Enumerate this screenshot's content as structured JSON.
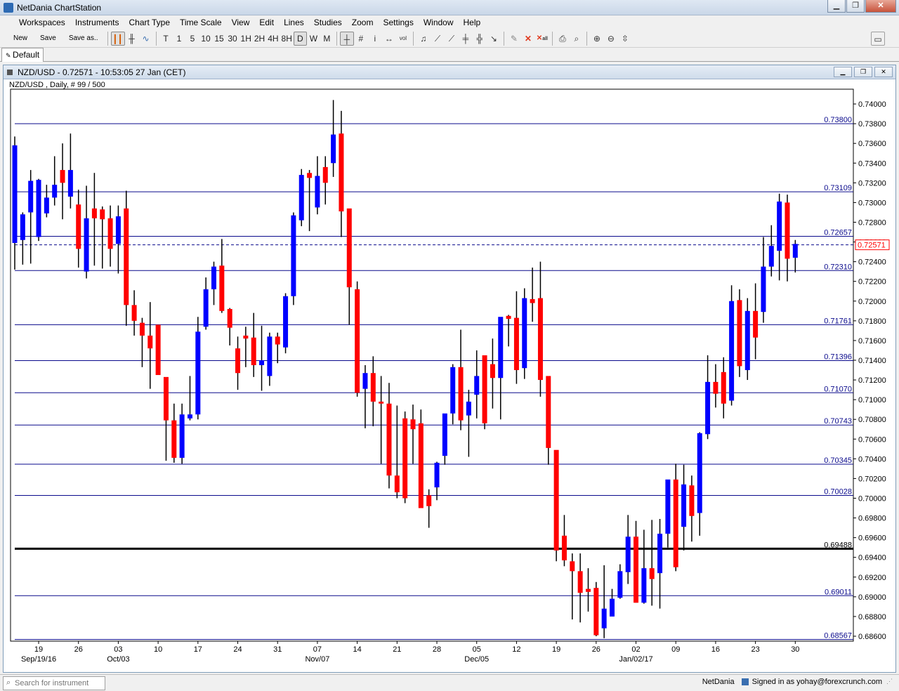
{
  "window": {
    "title": "NetDania ChartStation"
  },
  "window_controls": {
    "minimize": "▁",
    "restore": "❐",
    "close": "✕"
  },
  "menu": [
    "Workspaces",
    "Instruments",
    "Chart Type",
    "Time Scale",
    "View",
    "Edit",
    "Lines",
    "Studies",
    "Zoom",
    "Settings",
    "Window",
    "Help"
  ],
  "toolbar": {
    "new_label": "New",
    "save_label": "Save",
    "saveas_label": "Save as..",
    "timeframes": [
      "T",
      "1",
      "5",
      "10",
      "15",
      "30",
      "1H",
      "2H",
      "4H",
      "8H",
      "D",
      "W",
      "M"
    ],
    "active_timeframe": "D",
    "vol_label": "vol",
    "all_label": "all"
  },
  "tabs": [
    {
      "label": "Default",
      "active": true
    }
  ],
  "chart_window": {
    "title": "NZD/USD - 0.72571 - 10:53:05  27 Jan (CET)"
  },
  "status": {
    "search_placeholder": "Search for instrument",
    "provider": "NetDania",
    "signed_in": "Signed in as yohay@forexcrunch.com"
  },
  "colors": {
    "bull": "#0000ff",
    "bear": "#ff0000",
    "hline": "#0a0a8c",
    "support": "#000000"
  },
  "chart_data": {
    "type": "candlestick",
    "info": "NZD/USD , Daily, # 99 / 500",
    "ylim": [
      0.6855,
      0.7415
    ],
    "y_ticks": [
      "0.74000",
      "0.73800",
      "0.73600",
      "0.73400",
      "0.73200",
      "0.73000",
      "0.72800",
      "0.72600",
      "0.72400",
      "0.72200",
      "0.72000",
      "0.71800",
      "0.71600",
      "0.71400",
      "0.71200",
      "0.71000",
      "0.70800",
      "0.70600",
      "0.70400",
      "0.70200",
      "0.70000",
      "0.69800",
      "0.69600",
      "0.69400",
      "0.69200",
      "0.69000",
      "0.68800",
      "0.68600"
    ],
    "x_labels": [
      {
        "i": 3,
        "day": "19",
        "month": "Sep/19/16"
      },
      {
        "i": 8,
        "day": "26",
        "month": ""
      },
      {
        "i": 13,
        "day": "03",
        "month": "Oct/03"
      },
      {
        "i": 18,
        "day": "10",
        "month": ""
      },
      {
        "i": 23,
        "day": "17",
        "month": ""
      },
      {
        "i": 28,
        "day": "24",
        "month": ""
      },
      {
        "i": 33,
        "day": "31",
        "month": ""
      },
      {
        "i": 38,
        "day": "07",
        "month": "Nov/07"
      },
      {
        "i": 43,
        "day": "14",
        "month": ""
      },
      {
        "i": 48,
        "day": "21",
        "month": ""
      },
      {
        "i": 53,
        "day": "28",
        "month": ""
      },
      {
        "i": 58,
        "day": "05",
        "month": "Dec/05"
      },
      {
        "i": 63,
        "day": "12",
        "month": ""
      },
      {
        "i": 68,
        "day": "19",
        "month": ""
      },
      {
        "i": 73,
        "day": "26",
        "month": ""
      },
      {
        "i": 78,
        "day": "02",
        "month": "Jan/02/17"
      },
      {
        "i": 83,
        "day": "09",
        "month": ""
      },
      {
        "i": 88,
        "day": "16",
        "month": ""
      },
      {
        "i": 93,
        "day": "23",
        "month": ""
      },
      {
        "i": 98,
        "day": "30",
        "month": ""
      }
    ],
    "hlines": [
      {
        "value": 0.738,
        "label": "0.73800",
        "thick": false
      },
      {
        "value": 0.73109,
        "label": "0.73109",
        "thick": false
      },
      {
        "value": 0.72657,
        "label": "0.72657",
        "thick": false
      },
      {
        "value": 0.7231,
        "label": "0.72310",
        "thick": false
      },
      {
        "value": 0.71761,
        "label": "0.71761",
        "thick": false
      },
      {
        "value": 0.71396,
        "label": "0.71396",
        "thick": false
      },
      {
        "value": 0.7107,
        "label": "0.71070",
        "thick": false
      },
      {
        "value": 0.70743,
        "label": "0.70743",
        "thick": false
      },
      {
        "value": 0.70345,
        "label": "0.70345",
        "thick": false
      },
      {
        "value": 0.70028,
        "label": "0.70028",
        "thick": false
      },
      {
        "value": 0.69488,
        "label": "0.69488",
        "thick": true
      },
      {
        "value": 0.69011,
        "label": "0.69011",
        "thick": false
      },
      {
        "value": 0.68567,
        "label": "0.68567",
        "thick": false
      }
    ],
    "current_price": {
      "value": 0.72571,
      "label": "0.72571"
    },
    "candles": [
      [
        0.7259,
        0.7367,
        0.7232,
        0.7358
      ],
      [
        0.7262,
        0.729,
        0.7237,
        0.7288
      ],
      [
        0.729,
        0.7333,
        0.7238,
        0.7322
      ],
      [
        0.7265,
        0.7324,
        0.7261,
        0.7323
      ],
      [
        0.7289,
        0.7318,
        0.7285,
        0.7305
      ],
      [
        0.7305,
        0.7347,
        0.7297,
        0.7318
      ],
      [
        0.7333,
        0.736,
        0.7283,
        0.732
      ],
      [
        0.7306,
        0.737,
        0.7294,
        0.7333
      ],
      [
        0.7298,
        0.7313,
        0.7234,
        0.7253
      ],
      [
        0.723,
        0.7317,
        0.7223,
        0.7284
      ],
      [
        0.7294,
        0.733,
        0.7236,
        0.7284
      ],
      [
        0.7293,
        0.7296,
        0.7233,
        0.7283
      ],
      [
        0.7284,
        0.7297,
        0.7235,
        0.7253
      ],
      [
        0.7258,
        0.7297,
        0.7228,
        0.7286
      ],
      [
        0.7294,
        0.7312,
        0.7175,
        0.7196
      ],
      [
        0.7196,
        0.7211,
        0.7165,
        0.718
      ],
      [
        0.7178,
        0.7183,
        0.7133,
        0.7165
      ],
      [
        0.7165,
        0.7199,
        0.7111,
        0.7152
      ],
      [
        0.7176,
        0.7174,
        0.7128,
        0.7125
      ],
      [
        0.7123,
        0.7095,
        0.7038,
        0.7079
      ],
      [
        0.7079,
        0.7096,
        0.7036,
        0.7041
      ],
      [
        0.7041,
        0.7096,
        0.7035,
        0.7085
      ],
      [
        0.7081,
        0.7124,
        0.7079,
        0.7085
      ],
      [
        0.7085,
        0.7184,
        0.708,
        0.7169
      ],
      [
        0.7174,
        0.7224,
        0.7171,
        0.7212
      ],
      [
        0.7212,
        0.724,
        0.7196,
        0.7235
      ],
      [
        0.7236,
        0.7263,
        0.7188,
        0.719
      ],
      [
        0.7192,
        0.7193,
        0.7155,
        0.7173
      ],
      [
        0.7152,
        0.7164,
        0.711,
        0.7127
      ],
      [
        0.7165,
        0.7174,
        0.7133,
        0.7162
      ],
      [
        0.7163,
        0.7188,
        0.7123,
        0.7135
      ],
      [
        0.7135,
        0.7175,
        0.7109,
        0.714
      ],
      [
        0.7124,
        0.7168,
        0.7114,
        0.7164
      ],
      [
        0.7164,
        0.7168,
        0.7137,
        0.7156
      ],
      [
        0.7153,
        0.7208,
        0.7147,
        0.7205
      ],
      [
        0.7205,
        0.729,
        0.7196,
        0.7287
      ],
      [
        0.7282,
        0.7334,
        0.7276,
        0.7328
      ],
      [
        0.733,
        0.7333,
        0.7271,
        0.7325
      ],
      [
        0.7295,
        0.7347,
        0.7288,
        0.7327
      ],
      [
        0.7336,
        0.7347,
        0.7298,
        0.732
      ],
      [
        0.734,
        0.7404,
        0.7326,
        0.7369
      ],
      [
        0.737,
        0.7393,
        0.7265,
        0.7291
      ],
      [
        0.7294,
        0.7292,
        0.7176,
        0.7214
      ],
      [
        0.7212,
        0.722,
        0.7103,
        0.7107
      ],
      [
        0.7111,
        0.7135,
        0.7071,
        0.7127
      ],
      [
        0.7127,
        0.7144,
        0.7073,
        0.7098
      ],
      [
        0.7098,
        0.7124,
        0.7035,
        0.7096
      ],
      [
        0.7096,
        0.7117,
        0.701,
        0.7023
      ],
      [
        0.7023,
        0.7094,
        0.7,
        0.7006
      ],
      [
        0.7081,
        0.7088,
        0.6995,
        0.7
      ],
      [
        0.708,
        0.7095,
        0.7035,
        0.707
      ],
      [
        0.7076,
        0.709,
        0.7003,
        0.699
      ],
      [
        0.7003,
        0.7009,
        0.697,
        0.6992
      ],
      [
        0.7011,
        0.7037,
        0.6998,
        0.7036
      ],
      [
        0.7043,
        0.7085,
        0.7034,
        0.7086
      ],
      [
        0.7086,
        0.7136,
        0.7075,
        0.7133
      ],
      [
        0.7133,
        0.7171,
        0.7069,
        0.7079
      ],
      [
        0.7084,
        0.711,
        0.7042,
        0.7098
      ],
      [
        0.7105,
        0.715,
        0.7081,
        0.7124
      ],
      [
        0.7145,
        0.7142,
        0.707,
        0.7076
      ],
      [
        0.7136,
        0.7162,
        0.7091,
        0.7122
      ],
      [
        0.7122,
        0.7182,
        0.708,
        0.7184
      ],
      [
        0.7185,
        0.7186,
        0.7154,
        0.7182
      ],
      [
        0.7183,
        0.721,
        0.7116,
        0.713
      ],
      [
        0.7132,
        0.7213,
        0.7121,
        0.7203
      ],
      [
        0.7202,
        0.7234,
        0.7179,
        0.7198
      ],
      [
        0.7203,
        0.724,
        0.7103,
        0.712
      ],
      [
        0.7124,
        0.7123,
        0.7034,
        0.7051
      ],
      [
        0.7049,
        0.7048,
        0.6936,
        0.6947
      ],
      [
        0.6962,
        0.6983,
        0.6931,
        0.6937
      ],
      [
        0.6936,
        0.6944,
        0.6877,
        0.6926
      ],
      [
        0.6926,
        0.6944,
        0.6874,
        0.6904
      ],
      [
        0.6908,
        0.6929,
        0.6885,
        0.6905
      ],
      [
        0.6909,
        0.6915,
        0.686,
        0.6861
      ],
      [
        0.6868,
        0.6932,
        0.6858,
        0.6888
      ],
      [
        0.688,
        0.6908,
        0.688,
        0.6898
      ],
      [
        0.6899,
        0.6933,
        0.6898,
        0.6926
      ],
      [
        0.6925,
        0.6983,
        0.6913,
        0.6961
      ],
      [
        0.6961,
        0.6977,
        0.6894,
        0.6894
      ],
      [
        0.6894,
        0.6968,
        0.6893,
        0.6929
      ],
      [
        0.6929,
        0.6978,
        0.6891,
        0.6918
      ],
      [
        0.6924,
        0.6979,
        0.6888,
        0.6964
      ],
      [
        0.6964,
        0.6996,
        0.695,
        0.7019
      ],
      [
        0.7019,
        0.7035,
        0.6926,
        0.693
      ],
      [
        0.6971,
        0.7034,
        0.6947,
        0.7014
      ],
      [
        0.7013,
        0.7023,
        0.6956,
        0.6982
      ],
      [
        0.6985,
        0.7067,
        0.6962,
        0.7066
      ],
      [
        0.7065,
        0.7145,
        0.706,
        0.7118
      ],
      [
        0.7118,
        0.7136,
        0.7092,
        0.7106
      ],
      [
        0.7128,
        0.7143,
        0.7081,
        0.7096
      ],
      [
        0.7099,
        0.7216,
        0.7094,
        0.72
      ],
      [
        0.7201,
        0.7212,
        0.7123,
        0.7134
      ],
      [
        0.713,
        0.7203,
        0.712,
        0.719
      ],
      [
        0.719,
        0.7218,
        0.7141,
        0.7163
      ],
      [
        0.7189,
        0.7265,
        0.7178,
        0.7235
      ],
      [
        0.7235,
        0.7277,
        0.7225,
        0.7256
      ],
      [
        0.7251,
        0.7309,
        0.7221,
        0.7301
      ],
      [
        0.73,
        0.7308,
        0.722,
        0.7243
      ],
      [
        0.7244,
        0.7262,
        0.7229,
        0.7258
      ]
    ]
  }
}
